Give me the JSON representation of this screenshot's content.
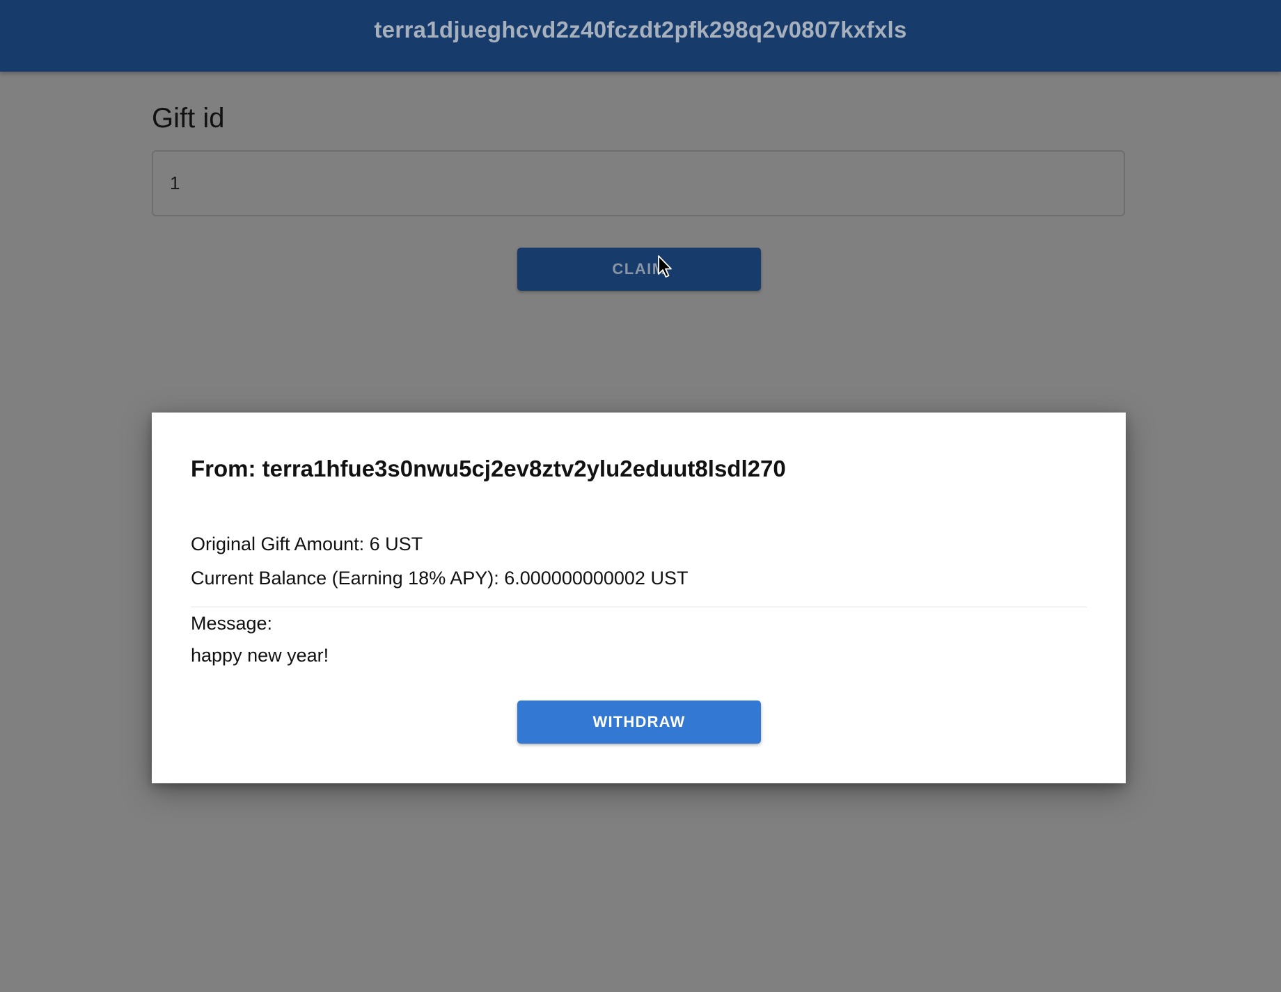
{
  "header": {
    "wallet_address": "terra1djueghcvd2z40fczdt2pfk298q2v0807kxfxls"
  },
  "form": {
    "gift_id_label": "Gift id",
    "gift_id_value": "1",
    "claim_label": "CLAIM"
  },
  "dialog": {
    "from": "From: terra1hfue3s0nwu5cj2ev8ztv2ylu2eduut8lsdl270",
    "original_amount": "Original Gift Amount: 6 UST",
    "current_balance": "Current Balance (Earning 18% APY): 6.000000000002 UST",
    "message_label": "Message:",
    "message_text": "happy new year!",
    "withdraw_label": "WITHDRAW"
  },
  "colors": {
    "header_bg": "#173b6a",
    "backdrop": "#808080",
    "withdraw_button": "#3378d2"
  },
  "icons": {
    "cursor": "mouse-pointer-icon"
  }
}
